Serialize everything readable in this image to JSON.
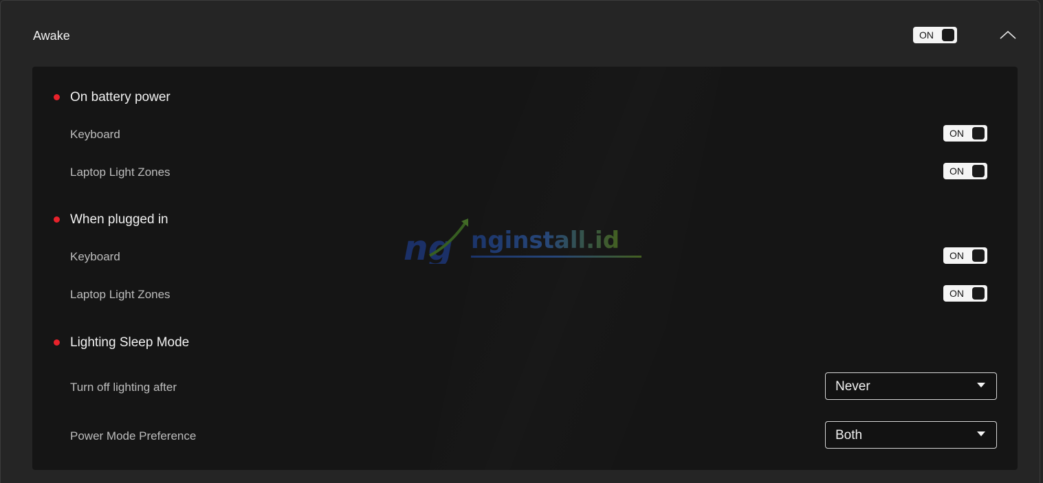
{
  "panel": {
    "title": "Awake",
    "toggle_label": "ON",
    "collapse_icon": "chevron-up-icon"
  },
  "sections": [
    {
      "title": "On battery power",
      "rows": [
        {
          "label": "Keyboard",
          "toggle_label": "ON"
        },
        {
          "label": "Laptop Light Zones",
          "toggle_label": "ON"
        }
      ]
    },
    {
      "title": "When plugged in",
      "rows": [
        {
          "label": "Keyboard",
          "toggle_label": "ON"
        },
        {
          "label": "Laptop Light Zones",
          "toggle_label": "ON"
        }
      ]
    },
    {
      "title": "Lighting Sleep Mode",
      "rows": [
        {
          "label": "Turn off lighting after",
          "value": "Never"
        },
        {
          "label": "Power Mode Preference",
          "value": "Both"
        }
      ]
    }
  ],
  "watermark": {
    "text": "nginstall.id",
    "logo_letters": "ng"
  },
  "colors": {
    "background": "#252525",
    "inner_panel": "#151515",
    "accent_dot": "#e8222b",
    "toggle_on": "#f5f5f5"
  }
}
